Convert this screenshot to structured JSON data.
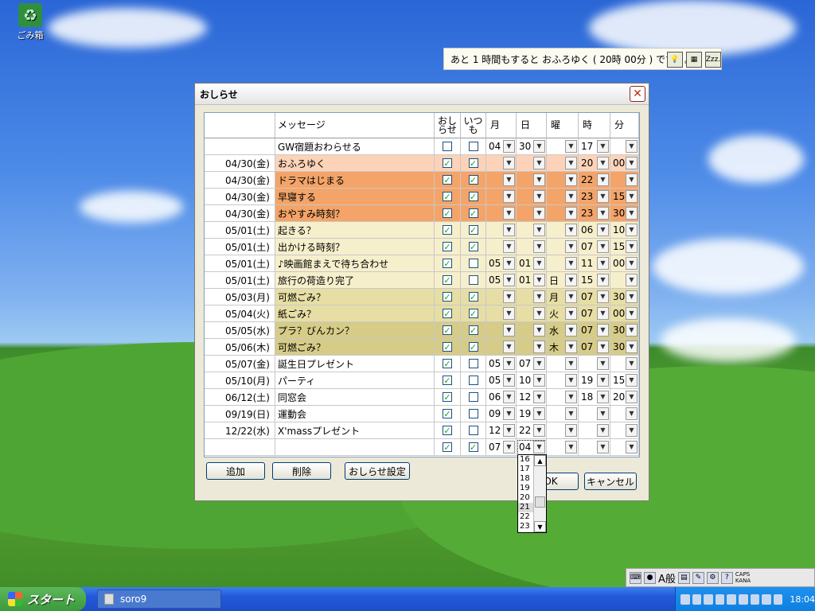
{
  "desktop": {
    "recycle_bin_label": "ごみ箱"
  },
  "balloon": {
    "text": "あと 1 時間もすると おふろゆく ( 20時 00分 ) ですよ。",
    "btn3_label": "Zzz."
  },
  "dialog": {
    "title": "おしらせ",
    "close_glyph": "✕",
    "headers": {
      "message": "メッセージ",
      "oshirase_1": "おし",
      "oshirase_2": "らせ",
      "itsumo_1": "いつ",
      "itsumo_2": "も",
      "month": "月",
      "day": "日",
      "weekday": "曜",
      "hour": "時",
      "minute": "分"
    },
    "rows": [
      {
        "date": "",
        "msg": "GW宿題おわらせる",
        "osh": false,
        "itm": false,
        "mon": "04",
        "day": "30",
        "wd": "",
        "hr": "17",
        "mn": "",
        "bg": "#ffffff"
      },
      {
        "date": "04/30(金)",
        "msg": "おふろゆく",
        "osh": true,
        "itm": true,
        "mon": "",
        "day": "",
        "wd": "",
        "hr": "20",
        "mn": "00",
        "bg": "#fcd3b8"
      },
      {
        "date": "04/30(金)",
        "msg": "ドラマはじまる",
        "osh": true,
        "itm": true,
        "mon": "",
        "day": "",
        "wd": "",
        "hr": "22",
        "mn": "",
        "bg": "#f4a468"
      },
      {
        "date": "04/30(金)",
        "msg": "早寝する",
        "osh": true,
        "itm": true,
        "mon": "",
        "day": "",
        "wd": "",
        "hr": "23",
        "mn": "15",
        "bg": "#f4a468"
      },
      {
        "date": "04/30(金)",
        "msg": "おやすみ時刻？",
        "osh": true,
        "itm": true,
        "mon": "",
        "day": "",
        "wd": "",
        "hr": "23",
        "mn": "30",
        "bg": "#f4a468"
      },
      {
        "date": "05/01(土)",
        "msg": "起きる？",
        "osh": true,
        "itm": true,
        "mon": "",
        "day": "",
        "wd": "",
        "hr": "06",
        "mn": "10",
        "bg": "#f6efcc"
      },
      {
        "date": "05/01(土)",
        "msg": "出かける時刻？",
        "osh": true,
        "itm": true,
        "mon": "",
        "day": "",
        "wd": "",
        "hr": "07",
        "mn": "15",
        "bg": "#f6efcc"
      },
      {
        "date": "05/01(土)",
        "msg": "♪映画館まえで待ち合わせ",
        "osh": true,
        "itm": false,
        "mon": "05",
        "day": "01",
        "wd": "",
        "hr": "11",
        "mn": "00",
        "bg": "#f6efcc"
      },
      {
        "date": "05/01(土)",
        "msg": "旅行の荷造り完了",
        "osh": true,
        "itm": false,
        "mon": "05",
        "day": "01",
        "wd": "日",
        "hr": "15",
        "mn": "",
        "bg": "#f6efcc"
      },
      {
        "date": "05/03(月)",
        "msg": "可燃ごみ？",
        "osh": true,
        "itm": true,
        "mon": "",
        "day": "",
        "wd": "月",
        "hr": "07",
        "mn": "30",
        "bg": "#e6dea4"
      },
      {
        "date": "05/04(火)",
        "msg": "紙ごみ？",
        "osh": true,
        "itm": true,
        "mon": "",
        "day": "",
        "wd": "火",
        "hr": "07",
        "mn": "00",
        "bg": "#e6dea4"
      },
      {
        "date": "05/05(水)",
        "msg": "プラ？びんカン？",
        "osh": true,
        "itm": true,
        "mon": "",
        "day": "",
        "wd": "水",
        "hr": "07",
        "mn": "30",
        "bg": "#d6cc88"
      },
      {
        "date": "05/06(木)",
        "msg": "可燃ごみ？",
        "osh": true,
        "itm": true,
        "mon": "",
        "day": "",
        "wd": "木",
        "hr": "07",
        "mn": "30",
        "bg": "#d6cc88"
      },
      {
        "date": "05/07(金)",
        "msg": "誕生日プレゼント",
        "osh": true,
        "itm": false,
        "mon": "05",
        "day": "07",
        "wd": "",
        "hr": "",
        "mn": "",
        "bg": "#ffffff"
      },
      {
        "date": "05/10(月)",
        "msg": "パーティ",
        "osh": true,
        "itm": false,
        "mon": "05",
        "day": "10",
        "wd": "",
        "hr": "19",
        "mn": "15",
        "bg": "#ffffff"
      },
      {
        "date": "06/12(土)",
        "msg": "同窓会",
        "osh": true,
        "itm": false,
        "mon": "06",
        "day": "12",
        "wd": "",
        "hr": "18",
        "mn": "20",
        "bg": "#ffffff"
      },
      {
        "date": "09/19(日)",
        "msg": "運動会",
        "osh": true,
        "itm": false,
        "mon": "09",
        "day": "19",
        "wd": "",
        "hr": "",
        "mn": "",
        "bg": "#ffffff"
      },
      {
        "date": "12/22(水)",
        "msg": "X'massプレゼント",
        "osh": true,
        "itm": false,
        "mon": "12",
        "day": "22",
        "wd": "",
        "hr": "",
        "mn": "",
        "bg": "#ffffff"
      },
      {
        "date": "",
        "msg": "",
        "osh": true,
        "itm": true,
        "mon": "07",
        "day": "04",
        "wd": "",
        "hr": "",
        "mn": "",
        "bg": "#ffffff",
        "new_row": true
      }
    ],
    "new_row_marker": "▶",
    "buttons": {
      "add": "追加",
      "delete": "削除",
      "settings": "おしらせ設定",
      "ok": "OK",
      "cancel": "キャンセル"
    }
  },
  "dropdown_list": {
    "options": [
      "16",
      "17",
      "18",
      "19",
      "20",
      "21",
      "22",
      "23"
    ],
    "highlighted": "21"
  },
  "langbar": {
    "mode_label": "A般",
    "caps": "CAPS",
    "kana": "KANA"
  },
  "taskbar": {
    "start_label": "スタート",
    "task_label": "soro9",
    "clock": "18:04"
  },
  "colors": {
    "check": "#21a121",
    "accent": "#2458d8"
  }
}
